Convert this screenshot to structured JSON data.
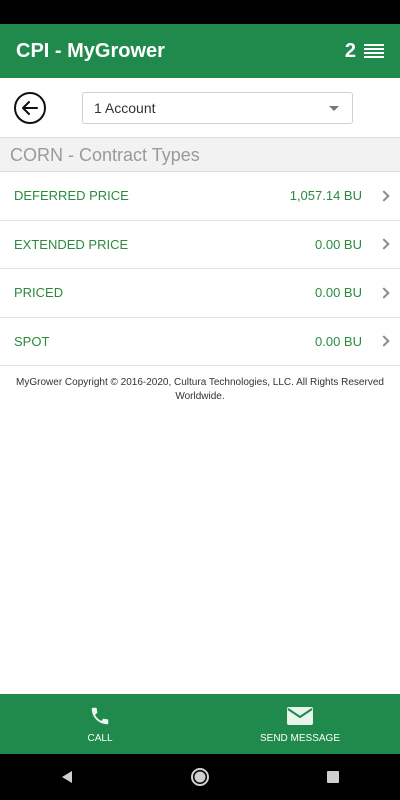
{
  "app": {
    "title": "CPI - MyGrower",
    "notification_count": "2"
  },
  "account_selector": {
    "value": "1 Account"
  },
  "section": {
    "title": "CORN - Contract Types"
  },
  "contract_types": [
    {
      "name": "DEFERRED PRICE",
      "value": "1,057.14 BU"
    },
    {
      "name": "EXTENDED PRICE",
      "value": "0.00 BU"
    },
    {
      "name": "PRICED",
      "value": "0.00 BU"
    },
    {
      "name": "SPOT",
      "value": "0.00 BU"
    }
  ],
  "footer": {
    "copyright": "MyGrower Copyright © 2016-2020, Cultura Technologies, LLC. All Rights Reserved Worldwide."
  },
  "bottom_nav": {
    "call_label": "CALL",
    "message_label": "SEND MESSAGE"
  },
  "colors": {
    "brand_green": "#1f8a4c",
    "text_green": "#2b8a3e"
  },
  "icons": [
    "menu-icon",
    "back-arrow-icon",
    "chevron-down-icon",
    "chevron-right-icon",
    "phone-icon",
    "envelope-icon",
    "back-triangle-icon",
    "home-circle-icon",
    "recents-square-icon"
  ]
}
